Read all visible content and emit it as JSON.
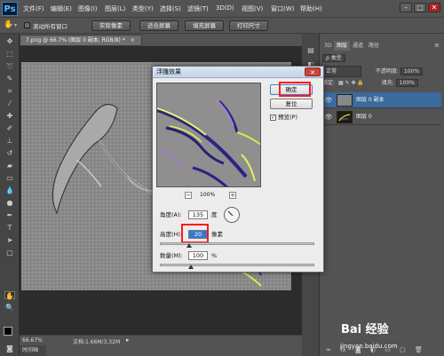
{
  "menubar": {
    "logo": "Ps",
    "items": [
      "文件(F)",
      "编辑(E)",
      "图像(I)",
      "图层(L)",
      "类型(Y)",
      "选择(S)",
      "滤镜(T)",
      "3D(D)",
      "视图(V)",
      "窗口(W)",
      "帮助(H)"
    ],
    "min": "–",
    "max": "□",
    "close": "✕"
  },
  "optbar": {
    "checkbox_label": "滚动所有窗口",
    "buttons": [
      "实际像素",
      "适合屏幕",
      "填充屏幕",
      "打印尺寸"
    ]
  },
  "document": {
    "tab_title": "7.png @ 66.7% (图层 0 副本, RGB/8) *",
    "tab_close": "×",
    "zoom": "66.67%",
    "doc_info": "文档:1.66M/3.32M",
    "timeline": "时间轴"
  },
  "layers_panel": {
    "tabs": [
      "3D",
      "图层",
      "通道",
      "路径"
    ],
    "kind_label": "ρ 类型",
    "blend_mode": "正常",
    "opacity_label": "不透明度:",
    "opacity_value": "100%",
    "lock_label": "锁定:",
    "fill_label": "填充:",
    "fill_value": "100%",
    "layers": [
      {
        "name": "图层 0 副本",
        "selected": true
      },
      {
        "name": "图层 0",
        "selected": false
      }
    ]
  },
  "dialog": {
    "title": "浮雕效果",
    "close": "✕",
    "ok": "确定",
    "reset": "复位",
    "preview_label": "预览(P)",
    "preview_checked": "✓",
    "zoom_out": "−",
    "zoom_in": "+",
    "zoom_level": "100%",
    "angle_label": "角度(A):",
    "angle_value": "135",
    "angle_unit": "度",
    "height_label": "高度(H):",
    "height_value": "20",
    "height_unit": "像素",
    "amount_label": "数量(M):",
    "amount_value": "100",
    "amount_unit": "%"
  },
  "watermark": {
    "logo": "Bai 经验",
    "url": "jingyan.baidu.com"
  },
  "colors": {
    "annotation_red": "#ff1a1a",
    "ps_blue": "#5bb9ff",
    "selected_layer": "#3b6a9c"
  }
}
